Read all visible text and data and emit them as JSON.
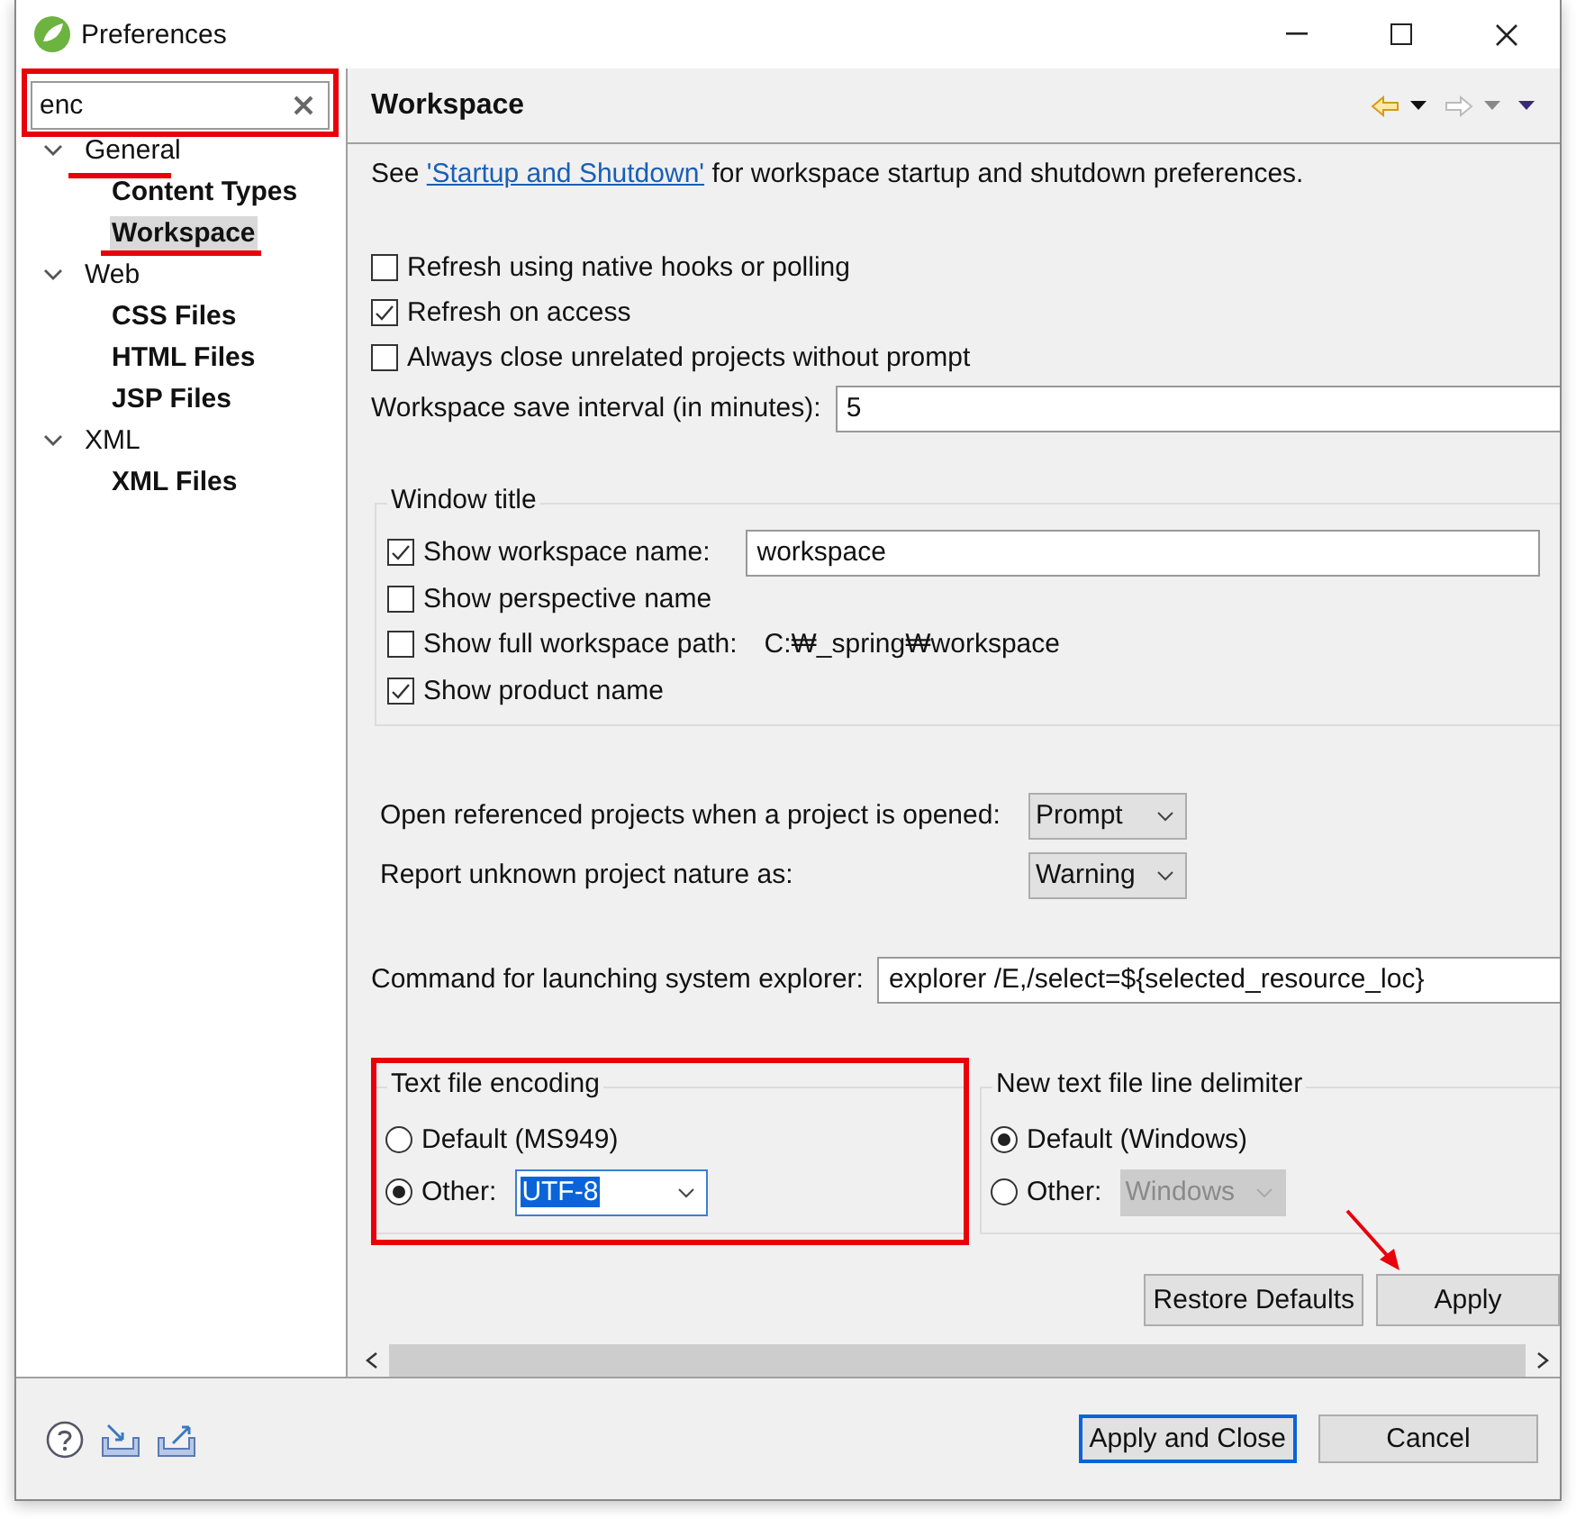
{
  "window": {
    "title": "Preferences"
  },
  "sidebar": {
    "filter": {
      "value": "enc"
    },
    "tree": [
      {
        "label": "General",
        "expanded": true,
        "children": [
          {
            "label": "Content Types",
            "selected": false
          },
          {
            "label": "Workspace",
            "selected": true
          }
        ]
      },
      {
        "label": "Web",
        "expanded": true,
        "children": [
          {
            "label": "CSS Files",
            "selected": false
          },
          {
            "label": "HTML Files",
            "selected": false
          },
          {
            "label": "JSP Files",
            "selected": false
          }
        ]
      },
      {
        "label": "XML",
        "expanded": true,
        "children": [
          {
            "label": "XML Files",
            "selected": false
          }
        ]
      }
    ]
  },
  "page": {
    "title": "Workspace",
    "intro": {
      "before": "See ",
      "link": "'Startup and Shutdown'",
      "after": " for workspace startup and shutdown preferences."
    },
    "checkboxes": [
      {
        "label": "Refresh using native hooks or polling",
        "checked": false
      },
      {
        "label": "Refresh on access",
        "checked": true
      },
      {
        "label": "Always close unrelated projects without prompt",
        "checked": false
      }
    ],
    "save_interval": {
      "label": "Workspace save interval (in minutes):",
      "value": "5"
    },
    "window_title": {
      "title": "Window title",
      "options": [
        {
          "kind": "field",
          "label": "Show workspace name:",
          "checked": true,
          "value": "workspace"
        },
        {
          "kind": "plain",
          "label": "Show perspective name",
          "checked": false
        },
        {
          "kind": "path",
          "label": "Show full workspace path:",
          "checked": false,
          "path": "C:₩_spring₩workspace"
        },
        {
          "kind": "plain",
          "label": "Show product name",
          "checked": true
        }
      ]
    },
    "dropdowns": [
      {
        "label": "Open referenced projects when a project is opened:",
        "value": "Prompt"
      },
      {
        "label": "Report unknown project nature as:",
        "value": "Warning"
      }
    ],
    "explorer": {
      "label": "Command for launching system explorer:",
      "value": "explorer /E,/select=${selected_resource_loc}"
    },
    "encoding": {
      "title": "Text file encoding",
      "options": [
        {
          "label": "Default (MS949)",
          "selected": false
        },
        {
          "label": "Other:",
          "selected": true,
          "combo": "UTF-8",
          "disabled": false
        }
      ]
    },
    "delimiter": {
      "title": "New text file line delimiter",
      "options": [
        {
          "label": "Default (Windows)",
          "selected": true
        },
        {
          "label": "Other:",
          "selected": false,
          "combo": "Windows",
          "disabled": true
        }
      ]
    },
    "buttons": [
      "Restore Defaults",
      "Apply"
    ]
  },
  "footer": {
    "buttons": [
      {
        "label": "Apply and Close",
        "default": true
      },
      {
        "label": "Cancel",
        "default": false
      }
    ]
  }
}
